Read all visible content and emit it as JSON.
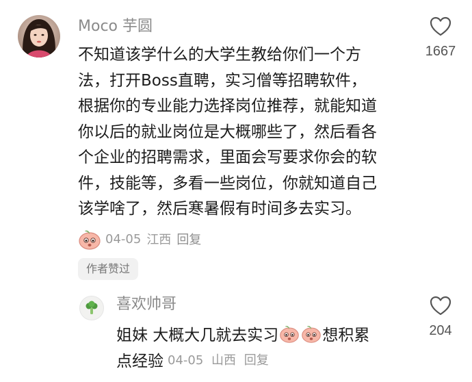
{
  "comment": {
    "username": "Moco 芋圆",
    "lines": [
      "不知道该学什么的大学生教给你们一个方",
      "法，打开Boss直聘，实习僧等招聘软件，",
      "根据你的专业能力选择岗位推荐，就能知道",
      "你以后的就业岗位是大概哪些了，然后看各",
      "个企业的招聘需求，里面会写要求你会的软",
      "件，技能等，多看一些岗位，你就知道自己",
      "该学啥了，然后寒暑假有时间多去实习。"
    ],
    "date": "04-05",
    "location": "江西",
    "reply_label": "回复",
    "like_count": "1667",
    "author_badge": "作者赞过",
    "sticker_icon": "peach-sticker-icon"
  },
  "reply": {
    "username": "喜欢帅哥",
    "text_before": "姐妹 大概大几就去实习 ",
    "text_after": "想积累",
    "text_line2": "点经验",
    "date": "04-05",
    "location": "山西",
    "reply_label": "回复",
    "like_count": "204",
    "avatar_icon": "broccoli-icon"
  },
  "colors": {
    "meta_gray": "#9a9a9a",
    "username_gray": "#8a8a8a",
    "sticker_peach": "#f7b7a8"
  }
}
